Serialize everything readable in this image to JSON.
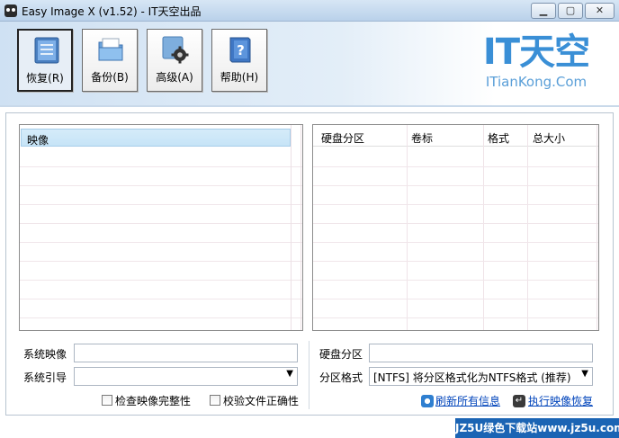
{
  "window": {
    "title": "Easy Image X (v1.52) - IT天空出品",
    "min_glyph": "▁",
    "max_glyph": "▢",
    "close_glyph": "✕"
  },
  "toolbar": {
    "items": [
      {
        "label": "恢复(R)",
        "icon": "restore-icon",
        "active": true
      },
      {
        "label": "备份(B)",
        "icon": "folder-icon",
        "active": false
      },
      {
        "label": "高级(A)",
        "icon": "gear-icon",
        "active": false
      },
      {
        "label": "帮助(H)",
        "icon": "help-book-icon",
        "active": false
      }
    ]
  },
  "logo": {
    "main": "IT天空",
    "sub": "ITianKong.Com"
  },
  "image_list": {
    "header": "映像"
  },
  "partition_list": {
    "columns": [
      "硬盘分区",
      "卷标",
      "格式",
      "总大小"
    ]
  },
  "form": {
    "system_image_label": "系统映像",
    "system_image_value": "",
    "system_boot_label": "系统引导",
    "system_boot_value": "",
    "disk_partition_label": "硬盘分区",
    "disk_partition_value": "",
    "partition_format_label": "分区格式",
    "partition_format_value": "[NTFS] 将分区格式化为NTFS格式 (推荐)",
    "check_integrity_label": "检查映像完整性",
    "verify_files_label": "校验文件正确性",
    "refresh_link": "刷新所有信息",
    "execute_link": "执行映像恢复"
  },
  "watermark": "JZ5U绿色下载站www.jz5u.com",
  "colors": {
    "accent": "#3a8fd6",
    "header_selected": "#c6e4f7",
    "link": "#0044bb"
  }
}
